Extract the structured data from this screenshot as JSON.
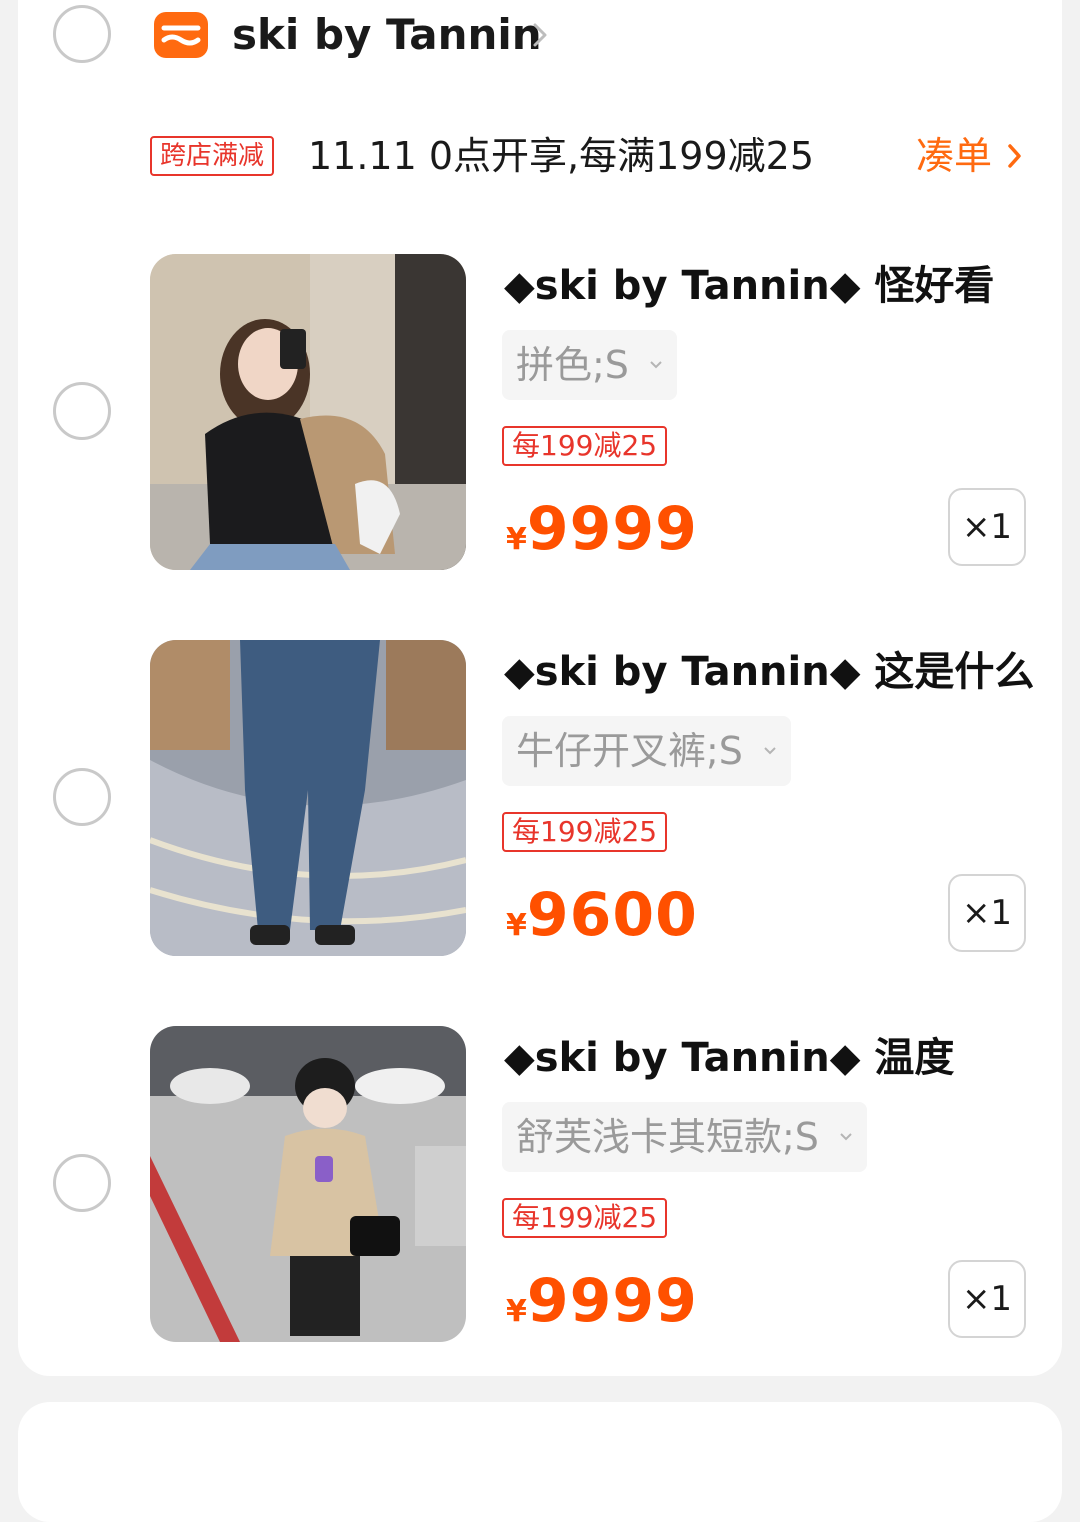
{
  "shop": {
    "name": "ski by Tannin",
    "promo_badge": "跨店满减",
    "promo_text": "11.11 0点开享,每满199减25",
    "collect_label": "凑单",
    "accent": "#ff5000"
  },
  "items": [
    {
      "title": "◆ski by Tannin◆ 怪好看",
      "sku": "拼色;S",
      "tag": "每199减25",
      "currency": "¥",
      "price": "9999",
      "qty": "×1"
    },
    {
      "title": "◆ski by Tannin◆ 这是什么",
      "sku": "牛仔开叉裤;S",
      "tag": "每199减25",
      "currency": "¥",
      "price": "9600",
      "qty": "×1"
    },
    {
      "title": "◆ski by Tannin◆ 温度",
      "sku": "舒芙浅卡其短款;S",
      "tag": "每199减25",
      "currency": "¥",
      "price": "9999",
      "qty": "×1"
    }
  ]
}
